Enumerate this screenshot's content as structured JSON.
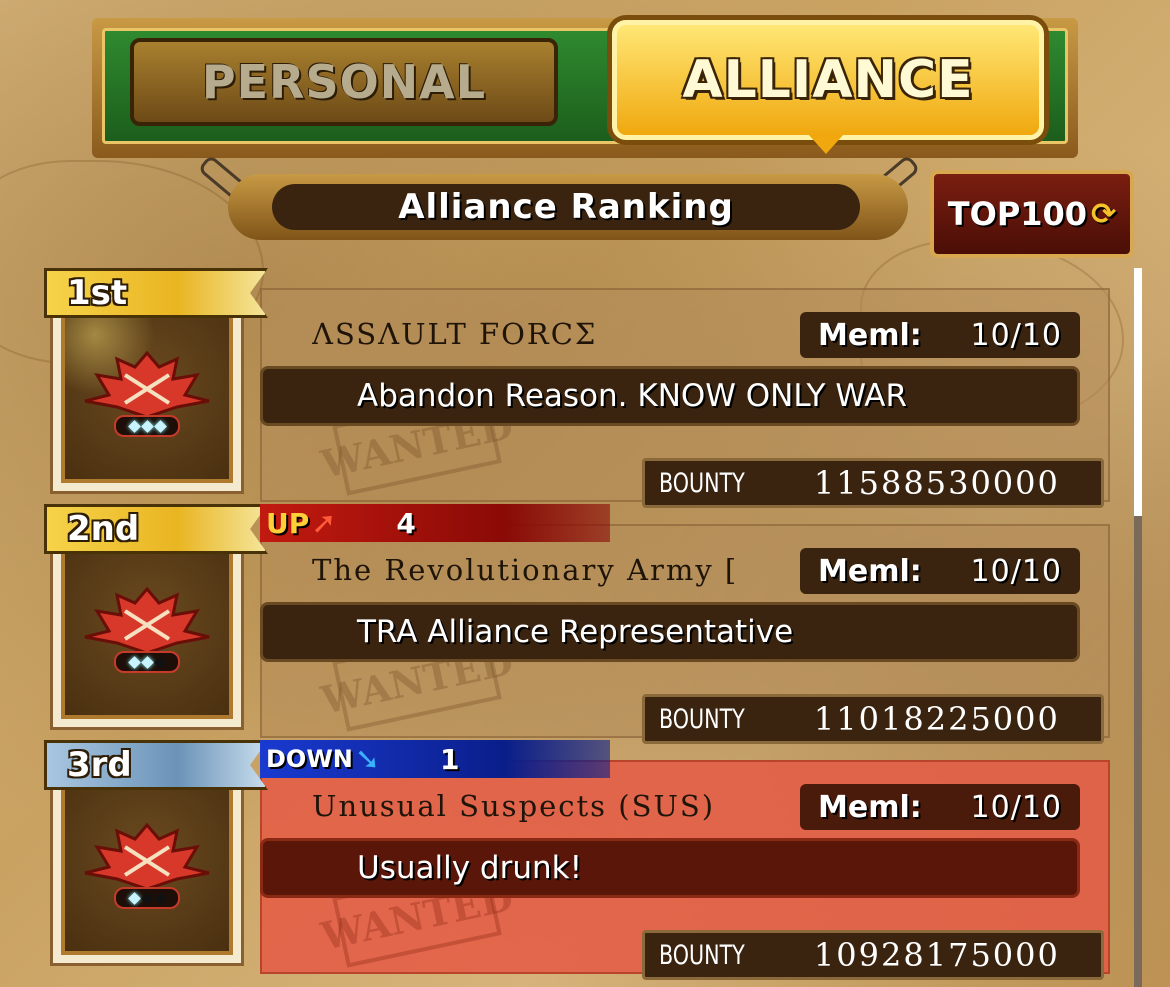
{
  "tabs": {
    "personal": "PERSONAL",
    "alliance": "ALLIANCE",
    "active": "alliance"
  },
  "ranking": {
    "title": "Alliance Ranking",
    "top100_label": "TOP100"
  },
  "entries": [
    {
      "rank": "1st",
      "name": "ΛSSΛULT FORCΣ",
      "member_label": "Meml:",
      "members": "10/10",
      "motto": "Abandon Reason. KNOW ONLY WAR",
      "bounty_label": "BOUNTY",
      "bounty": "11588530000",
      "move": null,
      "stars": [
        true,
        true,
        true
      ]
    },
    {
      "rank": "2nd",
      "name": "The Revolutionary Army [",
      "member_label": "Meml:",
      "members": "10/10",
      "motto": "TRA Alliance Representative",
      "bounty_label": "BOUNTY",
      "bounty": "11018225000",
      "move": {
        "direction": "UP",
        "count": "4"
      },
      "stars": [
        true,
        true,
        false
      ]
    },
    {
      "rank": "3rd",
      "name": "Unusual Suspects (SUS)",
      "member_label": "Meml:",
      "members": "10/10",
      "motto": "Usually drunk!",
      "bounty_label": "BOUNTY",
      "bounty": "10928175000",
      "move": {
        "direction": "DOWN",
        "count": "1"
      },
      "stars": [
        true,
        false,
        false
      ],
      "highlighted": true
    }
  ],
  "colors": {
    "alliance_tab": "#f0a80e",
    "highlight_row": "#e45c46",
    "up": "#c21a10",
    "down": "#1a3ad0"
  }
}
